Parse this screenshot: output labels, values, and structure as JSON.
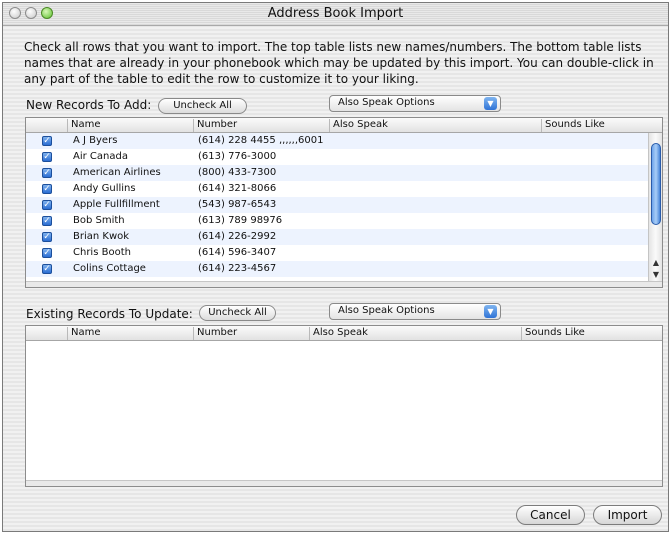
{
  "window": {
    "title": "Address Book Import"
  },
  "description": "Check all rows that you want to import.  The top table lists new names/numbers.  The bottom table lists names that are already in your phonebook which may be updated by this import.  You can double-click in any part of the table to edit the row to customize it to your liking.",
  "new_records": {
    "label": "New Records To Add:",
    "uncheck_label": "Uncheck All",
    "popup_label": "Also Speak Options",
    "columns": [
      "Name",
      "Number",
      "Also Speak",
      "Sounds Like"
    ],
    "rows": [
      {
        "checked": true,
        "name": "A J Byers",
        "number": "(614) 228 4455 ,,,,,,6001"
      },
      {
        "checked": true,
        "name": "Air Canada",
        "number": "(613) 776-3000"
      },
      {
        "checked": true,
        "name": "American Airlines",
        "number": "(800) 433-7300"
      },
      {
        "checked": true,
        "name": "Andy Gullins",
        "number": "(614) 321-8066"
      },
      {
        "checked": true,
        "name": "Apple Fullfillment",
        "number": "(543) 987-6543"
      },
      {
        "checked": true,
        "name": "Bob Smith",
        "number": "(613) 789 98976"
      },
      {
        "checked": true,
        "name": "Brian Kwok",
        "number": "(614) 226-2992"
      },
      {
        "checked": true,
        "name": "Chris Booth",
        "number": "(614) 596-3407"
      },
      {
        "checked": true,
        "name": "Colins Cottage",
        "number": "(614) 223-4567"
      }
    ]
  },
  "existing_records": {
    "label": "Existing Records To Update:",
    "uncheck_label": "Uncheck All",
    "popup_label": "Also Speak Options",
    "columns": [
      "Name",
      "Number",
      "Also Speak",
      "Sounds Like"
    ]
  },
  "buttons": {
    "cancel": "Cancel",
    "import": "Import"
  },
  "icons": {
    "check": "checkmark-icon",
    "popup_arrow": "chevron-down-icon",
    "scroll_up": "arrow-up-icon",
    "scroll_down": "arrow-down-icon"
  },
  "colors": {
    "accent": "#2f73d6",
    "alt_row": "#edf3fe"
  }
}
